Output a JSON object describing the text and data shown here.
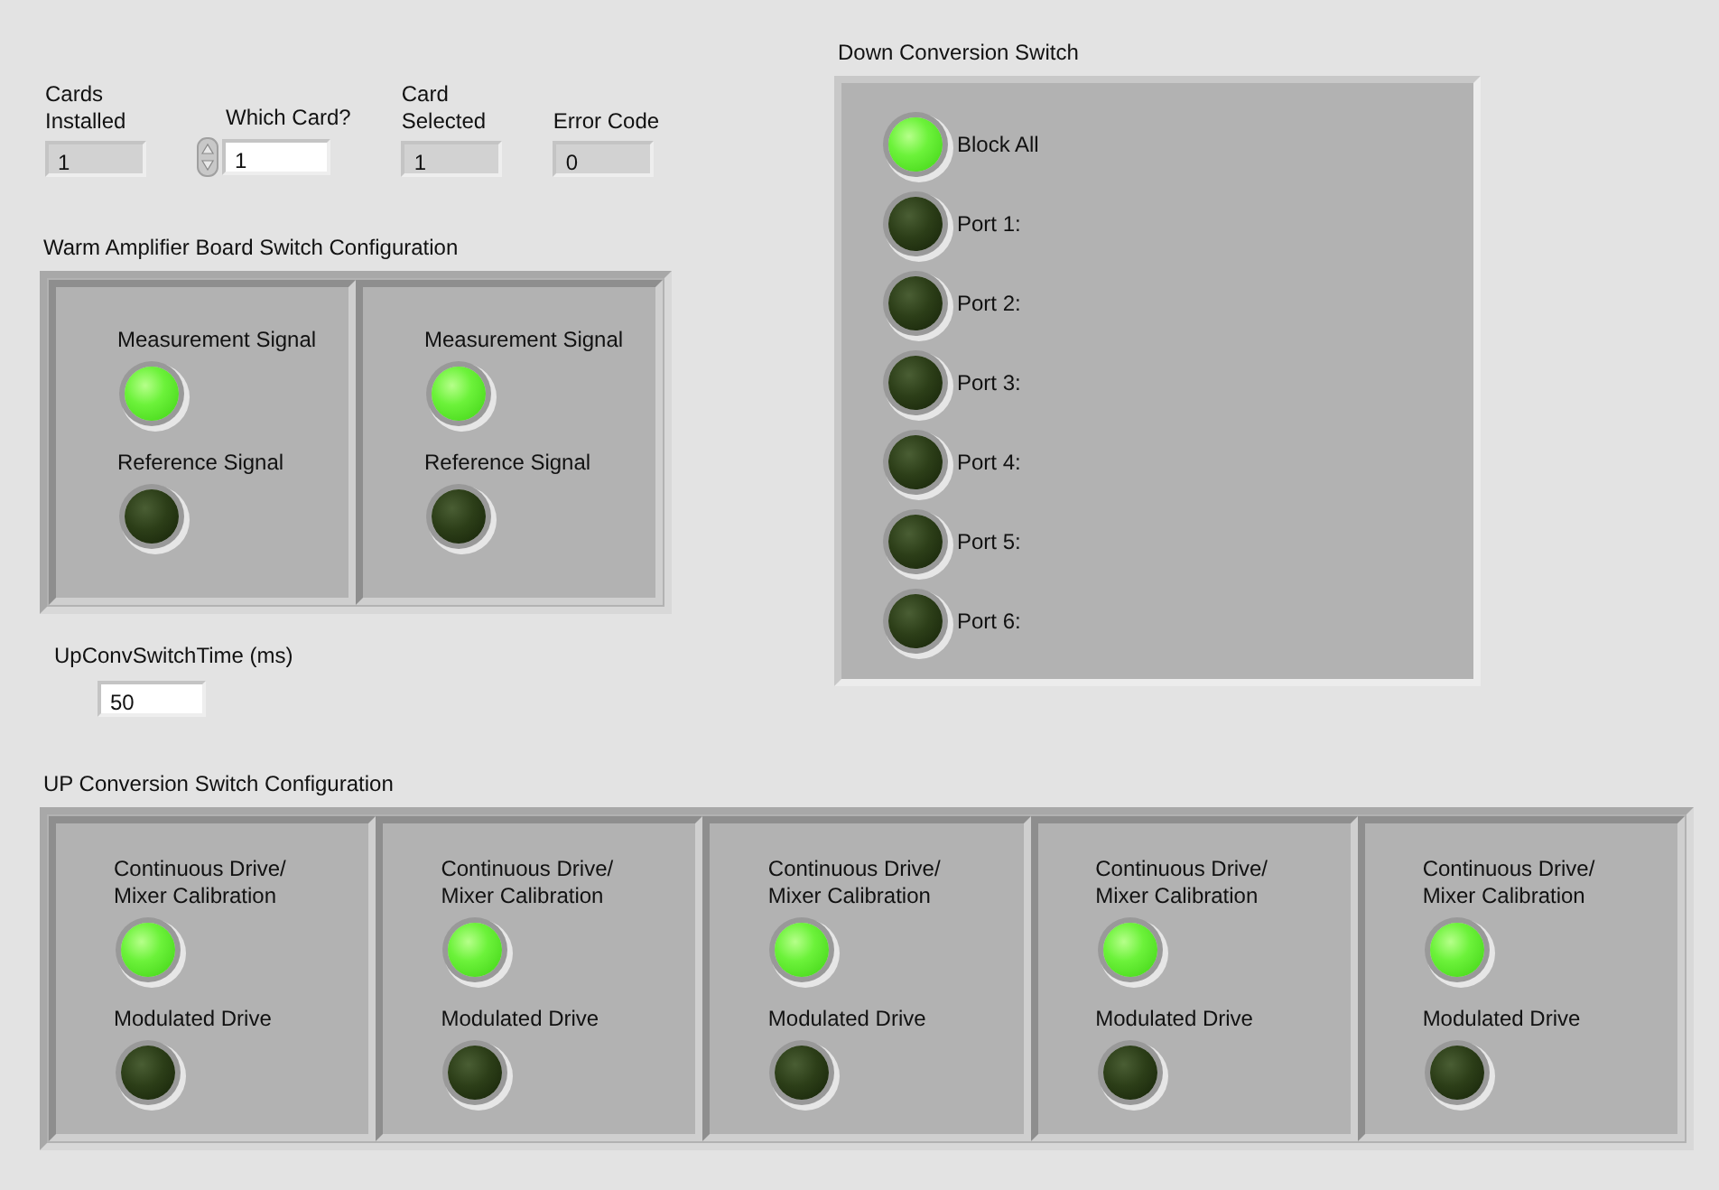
{
  "indicators": [
    {
      "kind": "readout",
      "label": "Cards\nInstalled",
      "value": "1"
    },
    {
      "kind": "spinner",
      "label": "Which Card?",
      "value": "1"
    },
    {
      "kind": "readout",
      "label": "Card\nSelected",
      "value": "1"
    },
    {
      "kind": "readout",
      "label": "Error Code",
      "value": "0"
    }
  ],
  "warm_amplifier": {
    "title": "Warm Amplifier Board Switch Configuration",
    "boards": [
      {
        "switches": [
          {
            "label": "Measurement Signal",
            "on": true
          },
          {
            "label": "Reference Signal",
            "on": false
          }
        ]
      },
      {
        "switches": [
          {
            "label": "Measurement Signal",
            "on": true
          },
          {
            "label": "Reference Signal",
            "on": false
          }
        ]
      }
    ]
  },
  "switch_time": {
    "label": "UpConvSwitchTime (ms)",
    "value": "50"
  },
  "down_conversion": {
    "title": "Down Conversion Switch",
    "switches": [
      {
        "label": "Block All",
        "on": true
      },
      {
        "label": "Port 1:",
        "on": false
      },
      {
        "label": "Port 2:",
        "on": false
      },
      {
        "label": "Port 3:",
        "on": false
      },
      {
        "label": "Port 4:",
        "on": false
      },
      {
        "label": "Port 5:",
        "on": false
      },
      {
        "label": "Port 6:",
        "on": false
      }
    ]
  },
  "up_conversion": {
    "title": "UP Conversion Switch Configuration",
    "boards": [
      {
        "switches": [
          {
            "label": "Continuous Drive/\nMixer Calibration",
            "on": true
          },
          {
            "label": "Modulated Drive",
            "on": false
          }
        ]
      },
      {
        "switches": [
          {
            "label": "Continuous Drive/\nMixer Calibration",
            "on": true
          },
          {
            "label": "Modulated Drive",
            "on": false
          }
        ]
      },
      {
        "switches": [
          {
            "label": "Continuous Drive/\nMixer Calibration",
            "on": true
          },
          {
            "label": "Modulated Drive",
            "on": false
          }
        ]
      },
      {
        "switches": [
          {
            "label": "Continuous Drive/\nMixer Calibration",
            "on": true
          },
          {
            "label": "Modulated Drive",
            "on": false
          }
        ]
      },
      {
        "switches": [
          {
            "label": "Continuous Drive/\nMixer Calibration",
            "on": true
          },
          {
            "label": "Modulated Drive",
            "on": false
          }
        ]
      }
    ]
  }
}
